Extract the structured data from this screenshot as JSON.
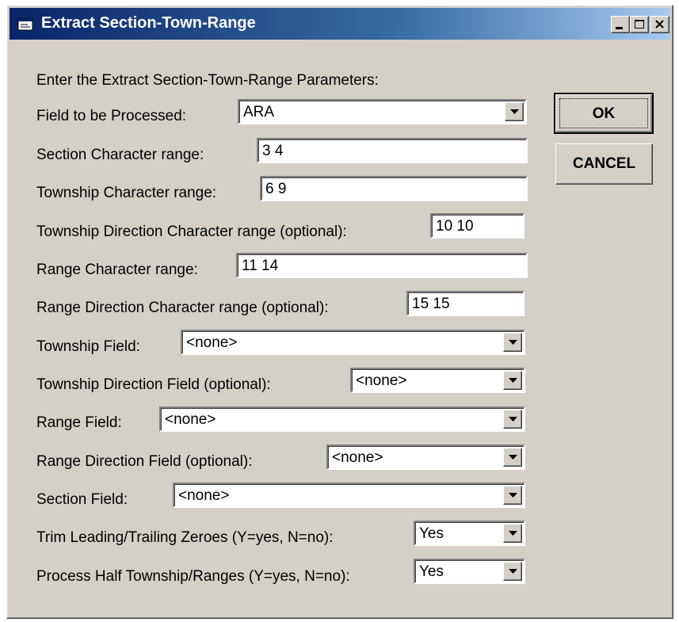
{
  "window": {
    "title": "Extract Section-Town-Range",
    "title_icon": "app-form-icon",
    "controls": [
      "minimize-icon",
      "maximize-icon",
      "close-icon"
    ]
  },
  "form": {
    "intro": "Enter the Extract Section-Town-Range Parameters:",
    "field_to_process": {
      "label": "Field to be Processed:",
      "value": "ARA"
    },
    "section_range": {
      "label": "Section Character range:",
      "value": "3 4"
    },
    "township_range": {
      "label": "Township Character range:",
      "value": "6 9"
    },
    "township_dir_range": {
      "label": "Township Direction Character range (optional):",
      "value": "10 10"
    },
    "range_range": {
      "label": "Range Character range:",
      "value": "11 14"
    },
    "range_dir_range": {
      "label": "Range Direction Character range (optional):",
      "value": "15 15"
    },
    "township_field": {
      "label": "Township Field:",
      "value": "<none>"
    },
    "township_dir_field": {
      "label": "Township Direction Field (optional):",
      "value": "<none>"
    },
    "range_field": {
      "label": "Range Field:",
      "value": "<none>"
    },
    "range_dir_field": {
      "label": "Range Direction Field (optional):",
      "value": "<none>"
    },
    "section_field": {
      "label": "Section Field:",
      "value": "<none>"
    },
    "trim_zeroes": {
      "label": "Trim Leading/Trailing Zeroes (Y=yes, N=no):",
      "value": "Yes"
    },
    "half_township": {
      "label": "Process Half Township/Ranges (Y=yes, N=no):",
      "value": "Yes"
    }
  },
  "buttons": {
    "ok": "OK",
    "cancel": "CANCEL"
  },
  "colors": {
    "title_gradient_start": "#0a246a",
    "title_gradient_end": "#a6caf0",
    "face": "#d4d0c8"
  }
}
